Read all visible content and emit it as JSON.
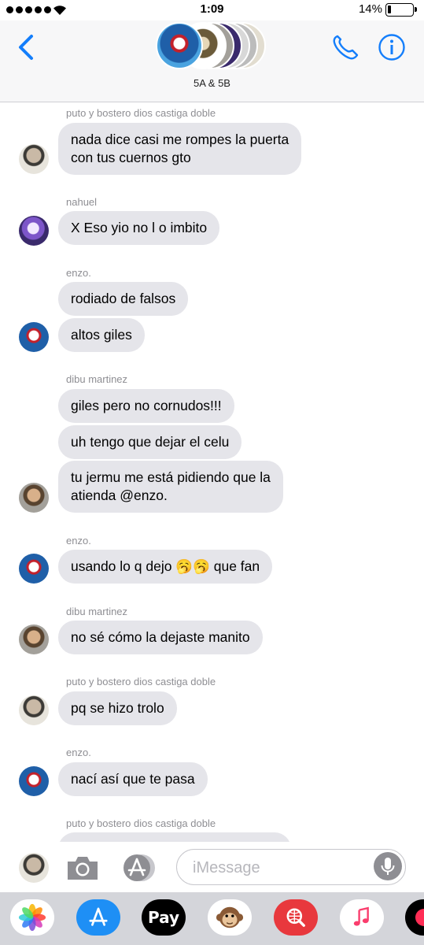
{
  "status_bar": {
    "time": "1:09",
    "battery": "14%",
    "battery_level": 0.14
  },
  "header": {
    "group_name": "5A & 5B",
    "back_icon": "chevron-left-icon",
    "call_icon": "phone-icon",
    "info_icon": "info-icon",
    "accent_color": "#147efb"
  },
  "messages": [
    {
      "sender": "puto y bostero dios castiga doble",
      "lines": [
        "nada dice casi me rompes la puerta",
        "con tus cuernos gto"
      ]
    },
    {
      "sender": "nahuel",
      "lines": [
        "X Eso yio no l o imbito"
      ]
    },
    {
      "sender": "enzo.",
      "lines": [
        "rodiado de falsos"
      ]
    },
    {
      "lines": [
        "altos giles"
      ]
    },
    {
      "sender": "dibu martinez",
      "lines": [
        "giles pero no cornudos!!!"
      ]
    },
    {
      "lines": [
        "uh tengo que dejar el celu"
      ]
    },
    {
      "lines": [
        "tu jermu me está pidiendo que la",
        "atienda @enzo."
      ]
    },
    {
      "sender": "enzo.",
      "lines": [
        "usando lo q dejo 🥱🥱 que fan"
      ]
    },
    {
      "sender": "dibu martinez",
      "lines": [
        "no sé cómo la dejaste manito"
      ]
    },
    {
      "sender": "puto y bostero dios castiga doble",
      "lines": [
        "pq se hizo trolo"
      ]
    },
    {
      "sender": "enzo.",
      "lines": [
        "nací así que te pasa"
      ]
    },
    {
      "sender": "puto y bostero dios castiga doble"
    }
  ],
  "input_bar": {
    "placeholder": "iMessage",
    "camera_icon": "camera-icon",
    "apps_icon": "app-store-icon",
    "mic_icon": "microphone-icon"
  },
  "app_drawer": {
    "apps": [
      {
        "name": "photos-icon"
      },
      {
        "name": "app-store-icon"
      },
      {
        "name": "apple-pay-icon",
        "label": "Pay"
      },
      {
        "name": "animoji-monkey-icon"
      },
      {
        "name": "web-search-icon"
      },
      {
        "name": "music-icon"
      },
      {
        "name": "heart-icon"
      }
    ]
  }
}
